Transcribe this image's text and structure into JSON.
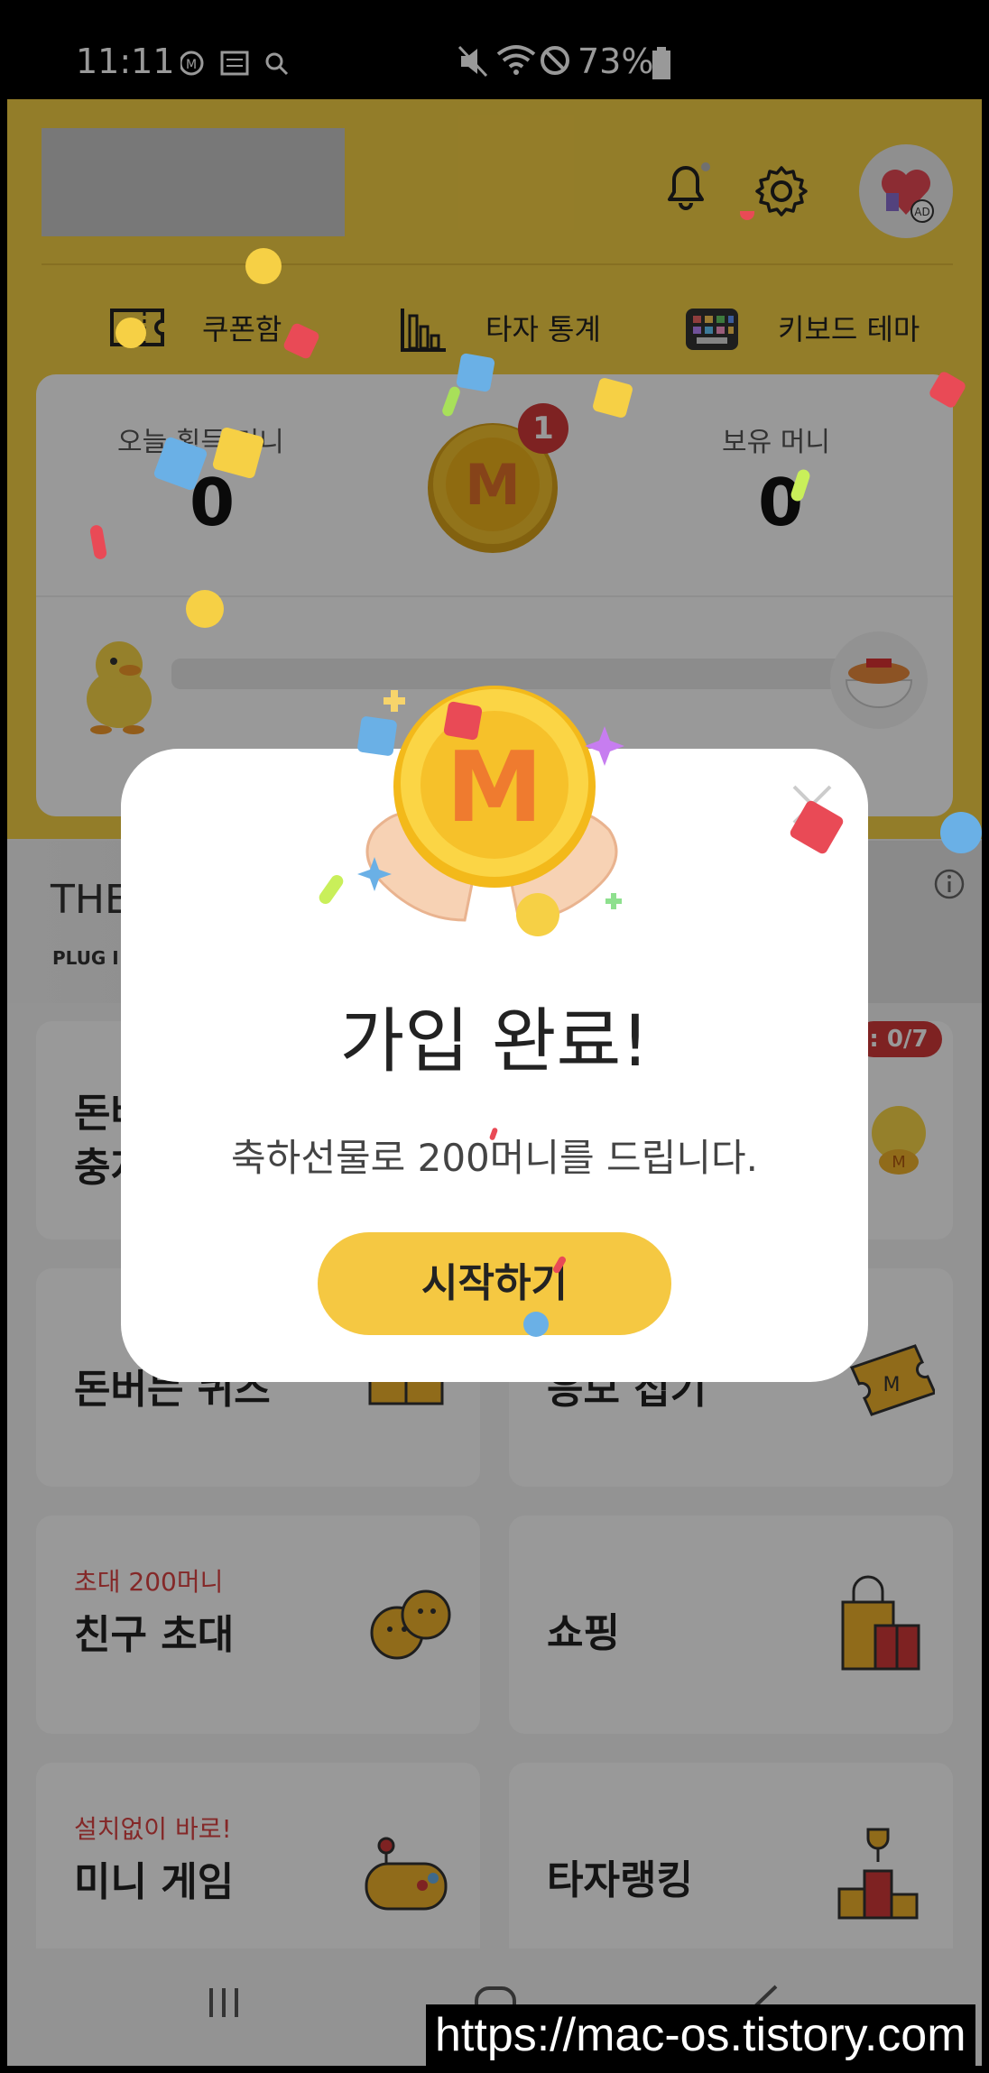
{
  "status_bar": {
    "time": "11:11",
    "battery": "73%"
  },
  "header": {
    "top_row": [
      {
        "icon": "coupon-icon",
        "label": "쿠폰함"
      },
      {
        "icon": "bar-chart-icon",
        "label": "타자 통계"
      },
      {
        "icon": "keyboard-icon",
        "label": "키보드 테마"
      }
    ],
    "ad_label": "AD"
  },
  "money": {
    "today_label": "오늘 획득 머니",
    "today_value": "0",
    "coin_badge": "1",
    "coin_letter": "M",
    "held_label": "보유 머니",
    "held_value": "0"
  },
  "ad_banner": {
    "title": "THE",
    "subtitle": "PLUG I"
  },
  "menu": [
    {
      "sub": "",
      "title": "돈버",
      "title2": "충지",
      "badge": ": 0/7"
    },
    {
      "sub": "",
      "title": "돈버는 퀴즈"
    },
    {
      "sub": "",
      "title": "응모 접기"
    },
    {
      "sub": "초대 200머니",
      "title": "친구 초대"
    },
    {
      "sub": "",
      "title": "쇼핑"
    },
    {
      "sub": "설치없이 바로!",
      "title": "미니 게임"
    },
    {
      "sub": "",
      "title": "타자랭킹"
    }
  ],
  "modal": {
    "coin_letter": "M",
    "title": "가입 완료!",
    "message": "축하선물로 200머니를 드립니다.",
    "button": "시작하기"
  },
  "watermark": "https://mac-os.tistory.com",
  "colors": {
    "accent_yellow": "#f6d045",
    "button_yellow": "#f5c842",
    "badge_red": "#d33a3a"
  }
}
